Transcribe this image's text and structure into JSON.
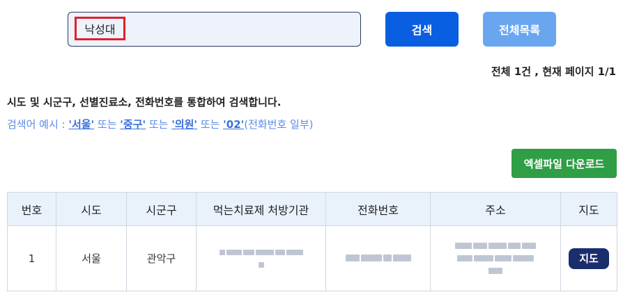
{
  "search": {
    "value": "낙성대",
    "search_button": "검색",
    "list_all_button": "전체목록"
  },
  "paging": {
    "summary": "전체 1건 ,  현재 페이지 1/1"
  },
  "help": {
    "title": "시도 및 시군구, 선별진료소, 전화번호를 통합하여 검색합니다.",
    "example_prefix": "검색어 예시 : ",
    "keywords": [
      "'서울'",
      "'중구'",
      "'의원'",
      "'02'"
    ],
    "joiner": " 또는 ",
    "example_suffix": "(전화번호 일부)"
  },
  "excel_button": "엑셀파일 다운로드",
  "table": {
    "headers": [
      "번호",
      "시도",
      "시군구",
      "먹는치료제 처방기관",
      "전화번호",
      "주소",
      "지도"
    ],
    "rows": [
      {
        "no": "1",
        "sido": "서울",
        "sigungu": "관악구",
        "map_button": "지도"
      }
    ]
  },
  "colors": {
    "primary": "#0a5fe0",
    "secondary": "#6aa6f0",
    "excel": "#2f9e44",
    "map": "#1a2e6e",
    "highlight": "#e0202a"
  }
}
